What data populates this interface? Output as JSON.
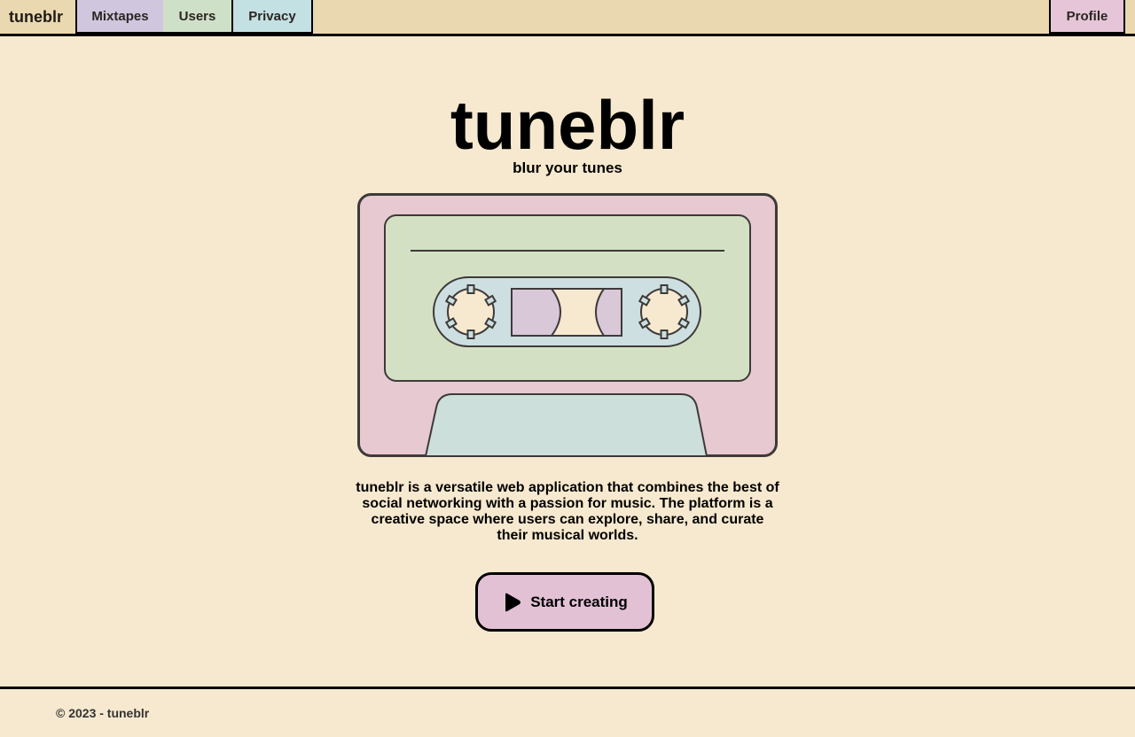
{
  "header": {
    "brand": "tuneblr",
    "nav": {
      "mixtapes": "Mixtapes",
      "users": "Users",
      "privacy": "Privacy"
    },
    "profile": "Profile"
  },
  "hero": {
    "title": "tuneblr",
    "subtitle": "blur your tunes",
    "description": "tuneblr is a versatile web application that combines the best of social networking with a passion for music. The platform is a creative space where users can explore, share, and curate their musical worlds.",
    "cta_label": "Start creating",
    "cta_icon": "play-icon"
  },
  "footer": {
    "text": "© 2023 - tuneblr"
  },
  "colors": {
    "background": "#f7e9cf",
    "topbar": "#ead8b0",
    "mixtapes_tab": "#d0c6de",
    "users_tab": "#cfe0c8",
    "privacy_tab": "#c3e0e3",
    "profile_tab": "#e5c5d7",
    "cassette_body": "#e6c9d1",
    "cassette_label": "#d4e0c3",
    "cassette_window": "#cddfe0",
    "cta": "#e3c1d5"
  }
}
